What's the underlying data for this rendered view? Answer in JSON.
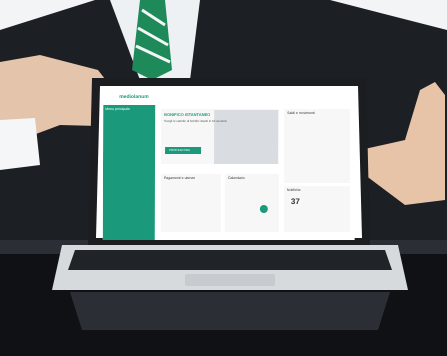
{
  "scene": {
    "subject": "businessman presenting laptop",
    "colors": {
      "suit": "#1c1f24",
      "shirt": "#eef1f4",
      "tie": "#1e8a5a",
      "desk": "#0f1114",
      "accent": "#1a9a7a",
      "laptop": "#d7dadd"
    }
  },
  "screen": {
    "brand": "mediolanum",
    "sidebar_title": "Menu principale",
    "promo": {
      "heading": "BONIFICO ISTANTANEO",
      "subheading": "Scegli le cartelle di bonifici istanti in 10 secondi",
      "button": "PROCEDI ORA"
    },
    "panels": {
      "left": "Pagamenti e utenze",
      "middle": "Calendario",
      "right": "Notifiche"
    },
    "balance_title": "Saldi e movimenti",
    "notification_count": "37"
  }
}
